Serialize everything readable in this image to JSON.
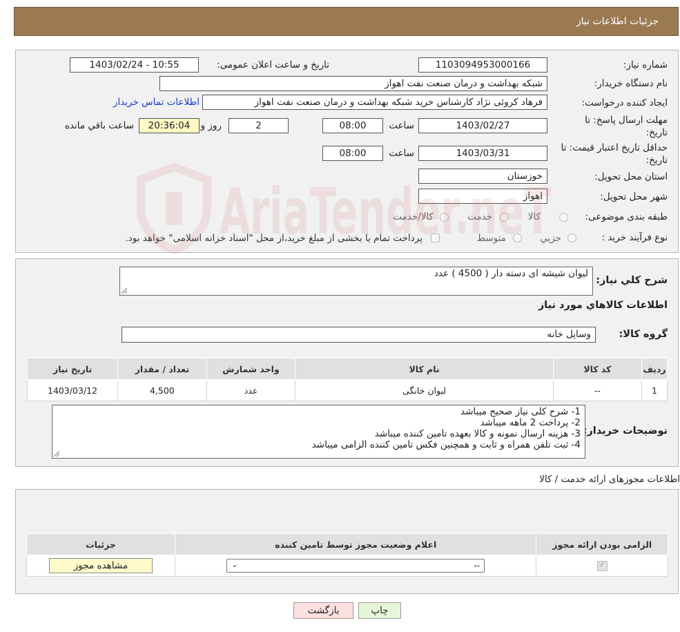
{
  "header": {
    "title": "جزئیات اطلاعات نیاز"
  },
  "form": {
    "need_number_label": "شماره نیاز:",
    "need_number": "1103094953000166",
    "announce_label": "تاریخ و ساعت اعلان عمومی:",
    "announce_value": "1403/02/24 - 10:55",
    "buyer_org_label": "نام دستگاه خریدار:",
    "buyer_org": "شبکه بهداشت و درمان صنعت نفت اهواز",
    "requester_label": "ایجاد کننده درخواست:",
    "requester": "فرهاد کروئی نژاد کارشناس خرید شبکه بهداشت و درمان صنعت نفت اهواز",
    "contact_link": "اطلاعات تماس خریدار",
    "deadline_label_1": "مهلت ارسال پاسخ: تا",
    "deadline_label_2": "تاریخ:",
    "deadline_date": "1403/02/27",
    "time_word": "ساعت",
    "deadline_time": "08:00",
    "days_value": "2",
    "days_word": "روز و",
    "remaining_time": "20:36:04",
    "remaining_word": "ساعت باقي مانده",
    "price_validity_label_1": "حداقل تاریخ اعتبار قیمت: تا",
    "price_validity_label_2": "تاریخ:",
    "price_validity_date": "1403/03/31",
    "price_validity_time": "08:00",
    "province_label": "استان محل تحویل:",
    "province": "خوزستان",
    "city_label": "شهر محل تحویل:",
    "city": "اهواز",
    "category_label": "طبقه بندی موضوعی:",
    "category_options": [
      "کالا",
      "خدمت",
      "کالا/خدمت"
    ],
    "process_label": "نوع فرآیند خرید :",
    "process_options": [
      "جزیي",
      "متوسط"
    ],
    "payment_note": "پرداخت تمام یا بخشی از مبلغ خرید،از محل \"اسناد خزانه اسلامی\" خواهد بود."
  },
  "details": {
    "summary_label": "شرح کلي نياز:",
    "summary": "لیوان شیشه ای دسته دار ( 4500 ) عدد",
    "goods_info_title": "اطلاعات کالاهاي مورد نياز",
    "goods_group_label": "گروه کالا:",
    "goods_group": "وسایل خانه",
    "table_headers": [
      "رديف",
      "کد کالا",
      "نام کالا",
      "واحد شمارش",
      "تعداد / مقدار",
      "تاریخ نیاز"
    ],
    "rows": [
      [
        "1",
        "--",
        "لیوان خانگی",
        "عدد",
        "4,500",
        "1403/03/12"
      ]
    ],
    "buyer_notes_label": "توضیحات خریدار:",
    "buyer_notes": [
      "1- شرح کلی نیاز صحیح میباشد",
      "2- پرداخت 2 ماهه میباشد",
      "3- هزینه ارسال نمونه و کالا بعهده تامین کننده میباشد",
      "4- ثبت تلفن همراه و ثابت و همچنین فکس تامین کننده الزامی میباشد"
    ]
  },
  "permits": {
    "title": "اطلاعات مجوزهای ارائه خدمت / کالا",
    "headers": [
      "الزامی بودن ارائه مجوز",
      "اعلام وضعیت مجوز توسط تامین کننده",
      "جزئیات"
    ],
    "select_value": "--",
    "view_button": "مشاهده مجوز"
  },
  "buttons": {
    "print": "چاپ",
    "back": "بازگشت"
  },
  "watermark_text": "AriaTender.neT",
  "colors": {
    "header": "#9b7a52",
    "link": "#1a3cc9",
    "back_button": "#ffe0e0",
    "print_button": "#e6f7d9",
    "watermark": "#d88080"
  }
}
